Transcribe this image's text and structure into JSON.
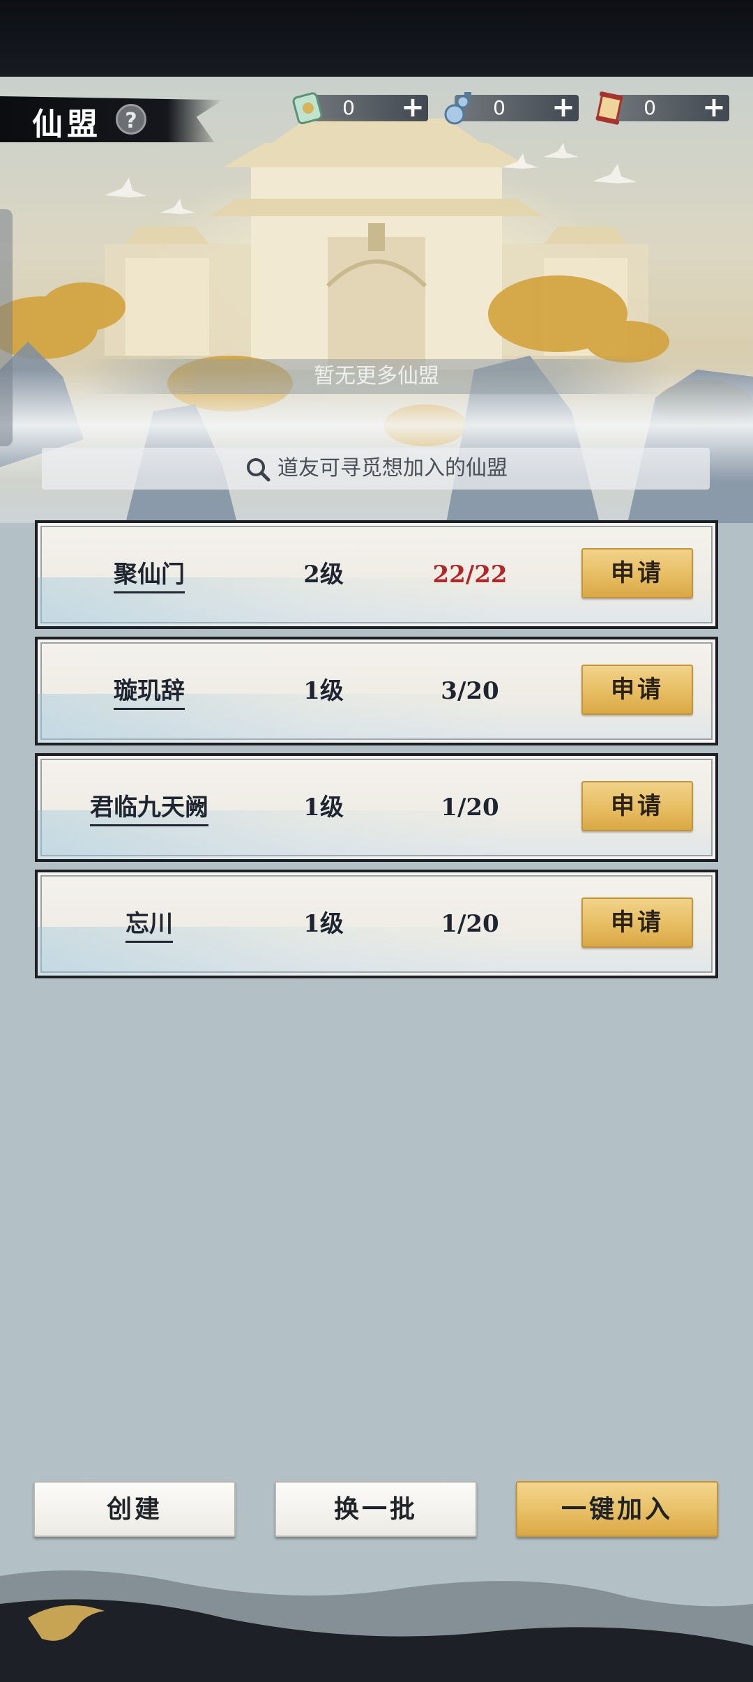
{
  "header": {
    "title": "仙盟",
    "help_symbol": "?"
  },
  "resources": [
    {
      "icon": "jade-token-icon",
      "value": "0",
      "plus": "+"
    },
    {
      "icon": "gourd-bottle-icon",
      "value": "0",
      "plus": "+"
    },
    {
      "icon": "scroll-icon",
      "value": "0",
      "plus": "+"
    }
  ],
  "notice": "暂无更多仙盟",
  "search": {
    "placeholder": "道友可寻觅想加入的仙盟"
  },
  "guilds": [
    {
      "name": "聚仙门",
      "level": "2级",
      "members": "22/22",
      "full": true,
      "apply": "申请"
    },
    {
      "name": "璇玑辞",
      "level": "1级",
      "members": "3/20",
      "full": false,
      "apply": "申请"
    },
    {
      "name": "君临九天阙",
      "level": "1级",
      "members": "1/20",
      "full": false,
      "apply": "申请"
    },
    {
      "name": "忘川",
      "level": "1级",
      "members": "1/20",
      "full": false,
      "apply": "申请"
    }
  ],
  "actions": {
    "create": "创建",
    "refresh": "换一批",
    "quick_join": "一键加入"
  },
  "colors": {
    "gold": "#e7bd62",
    "full_red": "#b3262a",
    "ink": "#1f2530",
    "background": "#b3c0c6"
  }
}
